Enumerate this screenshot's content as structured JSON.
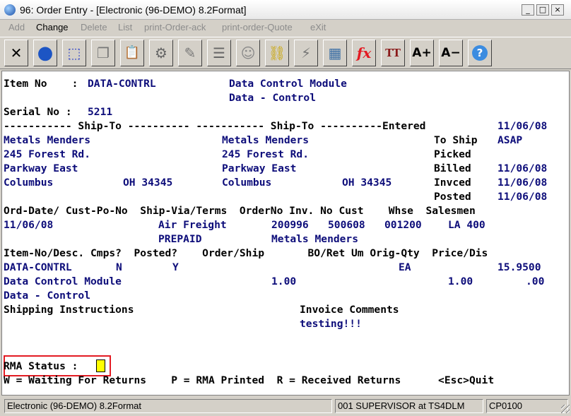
{
  "window": {
    "title": "96: Order Entry - [Electronic (96-DEMO) 8.2Format]",
    "controls": [
      "_",
      "□",
      "×"
    ]
  },
  "menu": [
    {
      "label": "Add",
      "enabled": false
    },
    {
      "label": "Change",
      "enabled": true
    },
    {
      "label": "Delete",
      "enabled": false
    },
    {
      "label": "List",
      "enabled": false
    },
    {
      "label": "print-Order-ack",
      "enabled": false
    },
    {
      "label": "print-order-Quote",
      "enabled": false
    },
    {
      "label": "eXit",
      "enabled": false
    }
  ],
  "toolbar": [
    {
      "icon": "close-x-icon",
      "glyph": "✕"
    },
    {
      "icon": "globe-icon",
      "glyph": "●"
    },
    {
      "icon": "select-rect-icon",
      "glyph": "⬚"
    },
    {
      "icon": "copy-icon",
      "glyph": "❐"
    },
    {
      "icon": "paste-icon",
      "glyph": "📋"
    },
    {
      "icon": "settings-gear-icon",
      "glyph": "⚙"
    },
    {
      "icon": "edit-form-icon",
      "glyph": "✎"
    },
    {
      "icon": "list-view-icon",
      "glyph": "☰"
    },
    {
      "icon": "users-icon",
      "glyph": "☺"
    },
    {
      "icon": "link-icon",
      "glyph": "⛓"
    },
    {
      "icon": "lightning-icon",
      "glyph": "⚡"
    },
    {
      "icon": "calendar-run-icon",
      "glyph": "▦"
    },
    {
      "icon": "function-fx-icon",
      "glyph": "fx"
    },
    {
      "icon": "font-size-icon",
      "glyph": "TT"
    },
    {
      "icon": "font-increase-icon",
      "glyph": "A+"
    },
    {
      "icon": "font-decrease-icon",
      "glyph": "A−"
    },
    {
      "icon": "help-icon",
      "glyph": "?"
    }
  ],
  "screen": {
    "item_no_label": "Item No    :",
    "item_no": "DATA-CONTRL",
    "item_desc1": "Data Control Module",
    "item_desc2": "Data - Control",
    "serial_label": "Serial No :",
    "serial_no": "5211",
    "shipto_header": "----------- Ship-To ---------- ----------- Ship-To ----------Entered",
    "entered_date": "11/06/08",
    "bill_name": "Metals Menders",
    "bill_addr": "245 Forest Rd.",
    "bill_city": "Parkway East",
    "bill_city2": "Columbus",
    "bill_state": "OH 34345",
    "ship_name": "Metals Menders",
    "ship_addr": "245 Forest Rd.",
    "ship_city": "Parkway East",
    "ship_city2": "Columbus",
    "ship_state": "OH 34345",
    "to_ship_label": "To Ship",
    "to_ship": "ASAP",
    "picked_label": "Picked",
    "billed_label": "Billed",
    "billed": "11/06/08",
    "invced_label": "Invced",
    "invced": "11/06/08",
    "posted_label": "Posted",
    "posted": "11/06/08",
    "order_header": "Ord-Date/ Cust-Po-No  Ship-Via/Terms  OrderNo Inv. No Cust    Whse  Salesmen",
    "ord_date": "11/06/08",
    "ship_via": "Air Freight",
    "order_no": "200996",
    "inv_no": "500608",
    "cust": "001200",
    "whse_sales": "LA 400",
    "terms": "PREPAID",
    "cust_name": "Metals Menders",
    "item_header": "Item-No/Desc. Cmps?  Posted?    Order/Ship       BO/Ret Um Orig-Qty  Price/Dis",
    "line_item": "DATA-CONTRL",
    "line_cmps": "N",
    "line_posted": "Y",
    "line_um": "EA",
    "line_price": "15.9500",
    "line_desc1": "Data Control Module",
    "line_order_ship": "1.00",
    "line_orig_qty": "1.00",
    "line_dis": ".00",
    "line_desc2": "Data - Control",
    "ship_instr_label": "Shipping Instructions",
    "inv_comments_label": "Invoice Comments",
    "inv_comment": "testing!!!",
    "rma_label": "RMA Status :",
    "rma_value": "",
    "help_line": "W = Waiting For Returns    P = RMA Printed  R = Received Returns      <Esc>Quit"
  },
  "status": {
    "company": "Electronic (96-DEMO) 8.2Format",
    "user": "001 SUPERVISOR at TS4DLM",
    "program": "CP0100"
  },
  "colors": {
    "accent_red": "#e31b23",
    "field_blue": "#0d0d7a",
    "cursor_yellow": "#ffff00"
  }
}
